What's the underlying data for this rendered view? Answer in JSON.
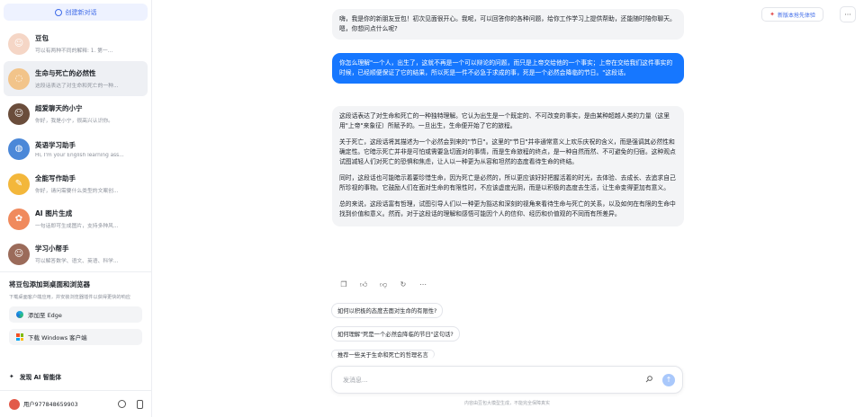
{
  "sidebar": {
    "new_chat": "创建新对话",
    "conversations": [
      {
        "title": "豆包",
        "subtitle": "可以有两种不同的解释: 1. 第一...",
        "color": "#f5d6c6"
      },
      {
        "title": "生命与死亡的必然性",
        "subtitle": "这段话表达了对生命和死亡的一种...",
        "color": "#f2c48a"
      },
      {
        "title": "超爱聊天的小宁",
        "subtitle": "你好，我是小宁，很高兴认识你。",
        "color": "#6a4d3b"
      },
      {
        "title": "英语学习助手",
        "subtitle": "Hi, I'm your English learning ass...",
        "color": "#4b88d8"
      },
      {
        "title": "全能写作助手",
        "subtitle": "你好，请问需要什么类型的文案创...",
        "color": "#f3b73b"
      },
      {
        "title": "AI 图片生成",
        "subtitle": "一句话即可生成图片，支持多种风...",
        "color": "#f08a5d"
      },
      {
        "title": "学习小帮手",
        "subtitle": "可以解答数学、语文、英语、科学...",
        "color": "#9b6b5a"
      }
    ],
    "promo": {
      "title": "将豆包添加到桌面和浏览器",
      "desc": "下载桌面客户端应用，并安装浏览器插件以获得更快的响应",
      "edge_btn": "添加至 Edge",
      "windows_btn": "下载 Windows 客户端"
    },
    "discover": "发现 AI 智能体",
    "user": "用户977848659903"
  },
  "header": {
    "new_version": "新版本抢先体验",
    "more": "···"
  },
  "messages": {
    "bot_greeting": "嗨，我是你的新朋友豆包！初次见面很开心。我呢，可以回答你的各种问题，给你工作学习上提供帮助，还能随时陪你聊天。嗯，你想问点什么呢?",
    "user_msg": "你怎么理解\"一个人，出生了，这就不再是一个可以辩论的问题，而只是上帝交给他的一个事实；上帝在交给我们这件事实的时候，已经顺便保证了它的结果，所以死是一件不必急于求成的事，死是一个必然会降临的节日。\"这段话。",
    "bot_paragraphs": [
      "这段话表达了对生命和死亡的一种独特理解。它认为出生是一个既定的、不可改变的事实，是由某种超越人类的力量（这里用\"上帝\"来象征）所赋予的。一旦出生，生命便开始了它的旅程。",
      "关于死亡，这段话将其描述为一个必然会到来的\"节日\"。这里的\"节日\"并非通常意义上欢乐庆祝的含义，而是强调其必然性和确定性。它暗示死亡并非是可怕或需要急切面对的事情，而是生命旅程的终点，是一种自然而然、不可避免的归宿。这种观点试图减轻人们对死亡的恐惧和焦虑，让人以一种更为从容和坦然的态度看待生命的终结。",
      "同时，这段话也可能暗示着要珍惜生命，因为死亡是必然的，所以更应该好好把握活着的时光，去体验、去成长、去追求自己所珍视的事物。它鼓励人们在面对生命的有限性时，不应该虚度光阴，而是以积极的态度去生活，让生命变得更加有意义。",
      "总的来说，这段话富有哲理，试图引导人们以一种更为豁达和深刻的视角来看待生命与死亡的关系，以及如何在有限的生命中找到价值和意义。然而，对于这段话的理解和感悟可能因个人的信仰、经历和价值观的不同而有所差异。"
    ]
  },
  "suggestions": [
    "如何以积极的态度去面对生命的有限性?",
    "如何理解\"死是一个必然会降临的节日\"这句话?",
    "推荐一些关于生命和死亡的哲理名言"
  ],
  "input": {
    "placeholder": "发消息..."
  },
  "disclaimer": "内容由豆包大模型生成，不能完全保障真实"
}
